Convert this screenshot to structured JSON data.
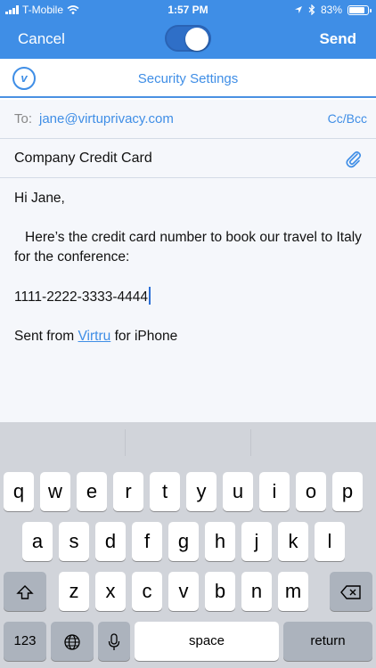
{
  "status": {
    "carrier": "T-Mobile",
    "time": "1:57 PM",
    "battery": "83%",
    "battery_level": 0.83
  },
  "nav": {
    "cancel_label": "Cancel",
    "send_label": "Send"
  },
  "security": {
    "logo_letter": "v",
    "title": "Security Settings"
  },
  "compose": {
    "to_label": "To:",
    "to_value": "jane@virtuprivacy.com",
    "ccbcc_label": "Cc/Bcc",
    "subject": "Company Credit Card",
    "greeting": "Hi Jane,",
    "paragraph": "Here’s the credit card number to book our travel to Italy for the conference:",
    "card_number": "1111-2222-3333-4444",
    "signature_pre": "Sent from ",
    "signature_link": "Virtru",
    "signature_post": " for iPhone"
  },
  "keyboard": {
    "row1": [
      "q",
      "w",
      "e",
      "r",
      "t",
      "y",
      "u",
      "i",
      "o",
      "p"
    ],
    "row2": [
      "a",
      "s",
      "d",
      "f",
      "g",
      "h",
      "j",
      "k",
      "l"
    ],
    "row3": [
      "z",
      "x",
      "c",
      "v",
      "b",
      "n",
      "m"
    ],
    "numbers_label": "123",
    "space_label": "space",
    "return_label": "return"
  },
  "colors": {
    "brand_blue": "#3f8ee6",
    "body_bg": "#f5f7fb",
    "keyboard_bg": "#d1d4da"
  }
}
